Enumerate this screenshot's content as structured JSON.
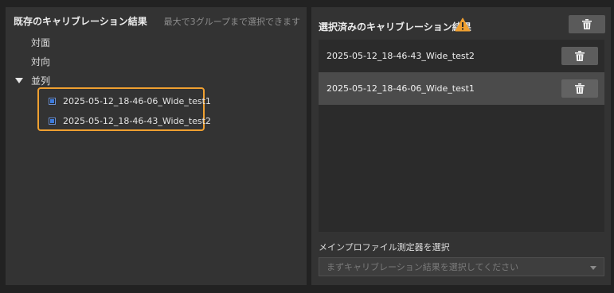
{
  "left_panel": {
    "title": "既存のキャリブレーション結果",
    "hint": "最大で3グループまで選択できます",
    "items": {
      "face": "対面",
      "opposite": "対向",
      "parallel": "並列"
    },
    "checked_items": [
      "2025-05-12_18-46-06_Wide_test1",
      "2025-05-12_18-46-43_Wide_test2"
    ]
  },
  "right_panel": {
    "title": "選択済みのキャリブレーション結果",
    "selected": [
      "2025-05-12_18-46-43_Wide_test2",
      "2025-05-12_18-46-06_Wide_test1"
    ],
    "select_label": "メインプロファイル測定器を選択",
    "dropdown_placeholder": "まずキャリブレーション結果を選択してください"
  },
  "icons": {
    "warning": "warning-icon",
    "trash": "trash-icon",
    "caret": "caret-down-icon",
    "dropdown_arrow": "chevron-down-icon"
  },
  "colors": {
    "highlight_border": "#f0a030",
    "warning": "#f0a030",
    "checkbox_fill": "#3d7bdc"
  }
}
